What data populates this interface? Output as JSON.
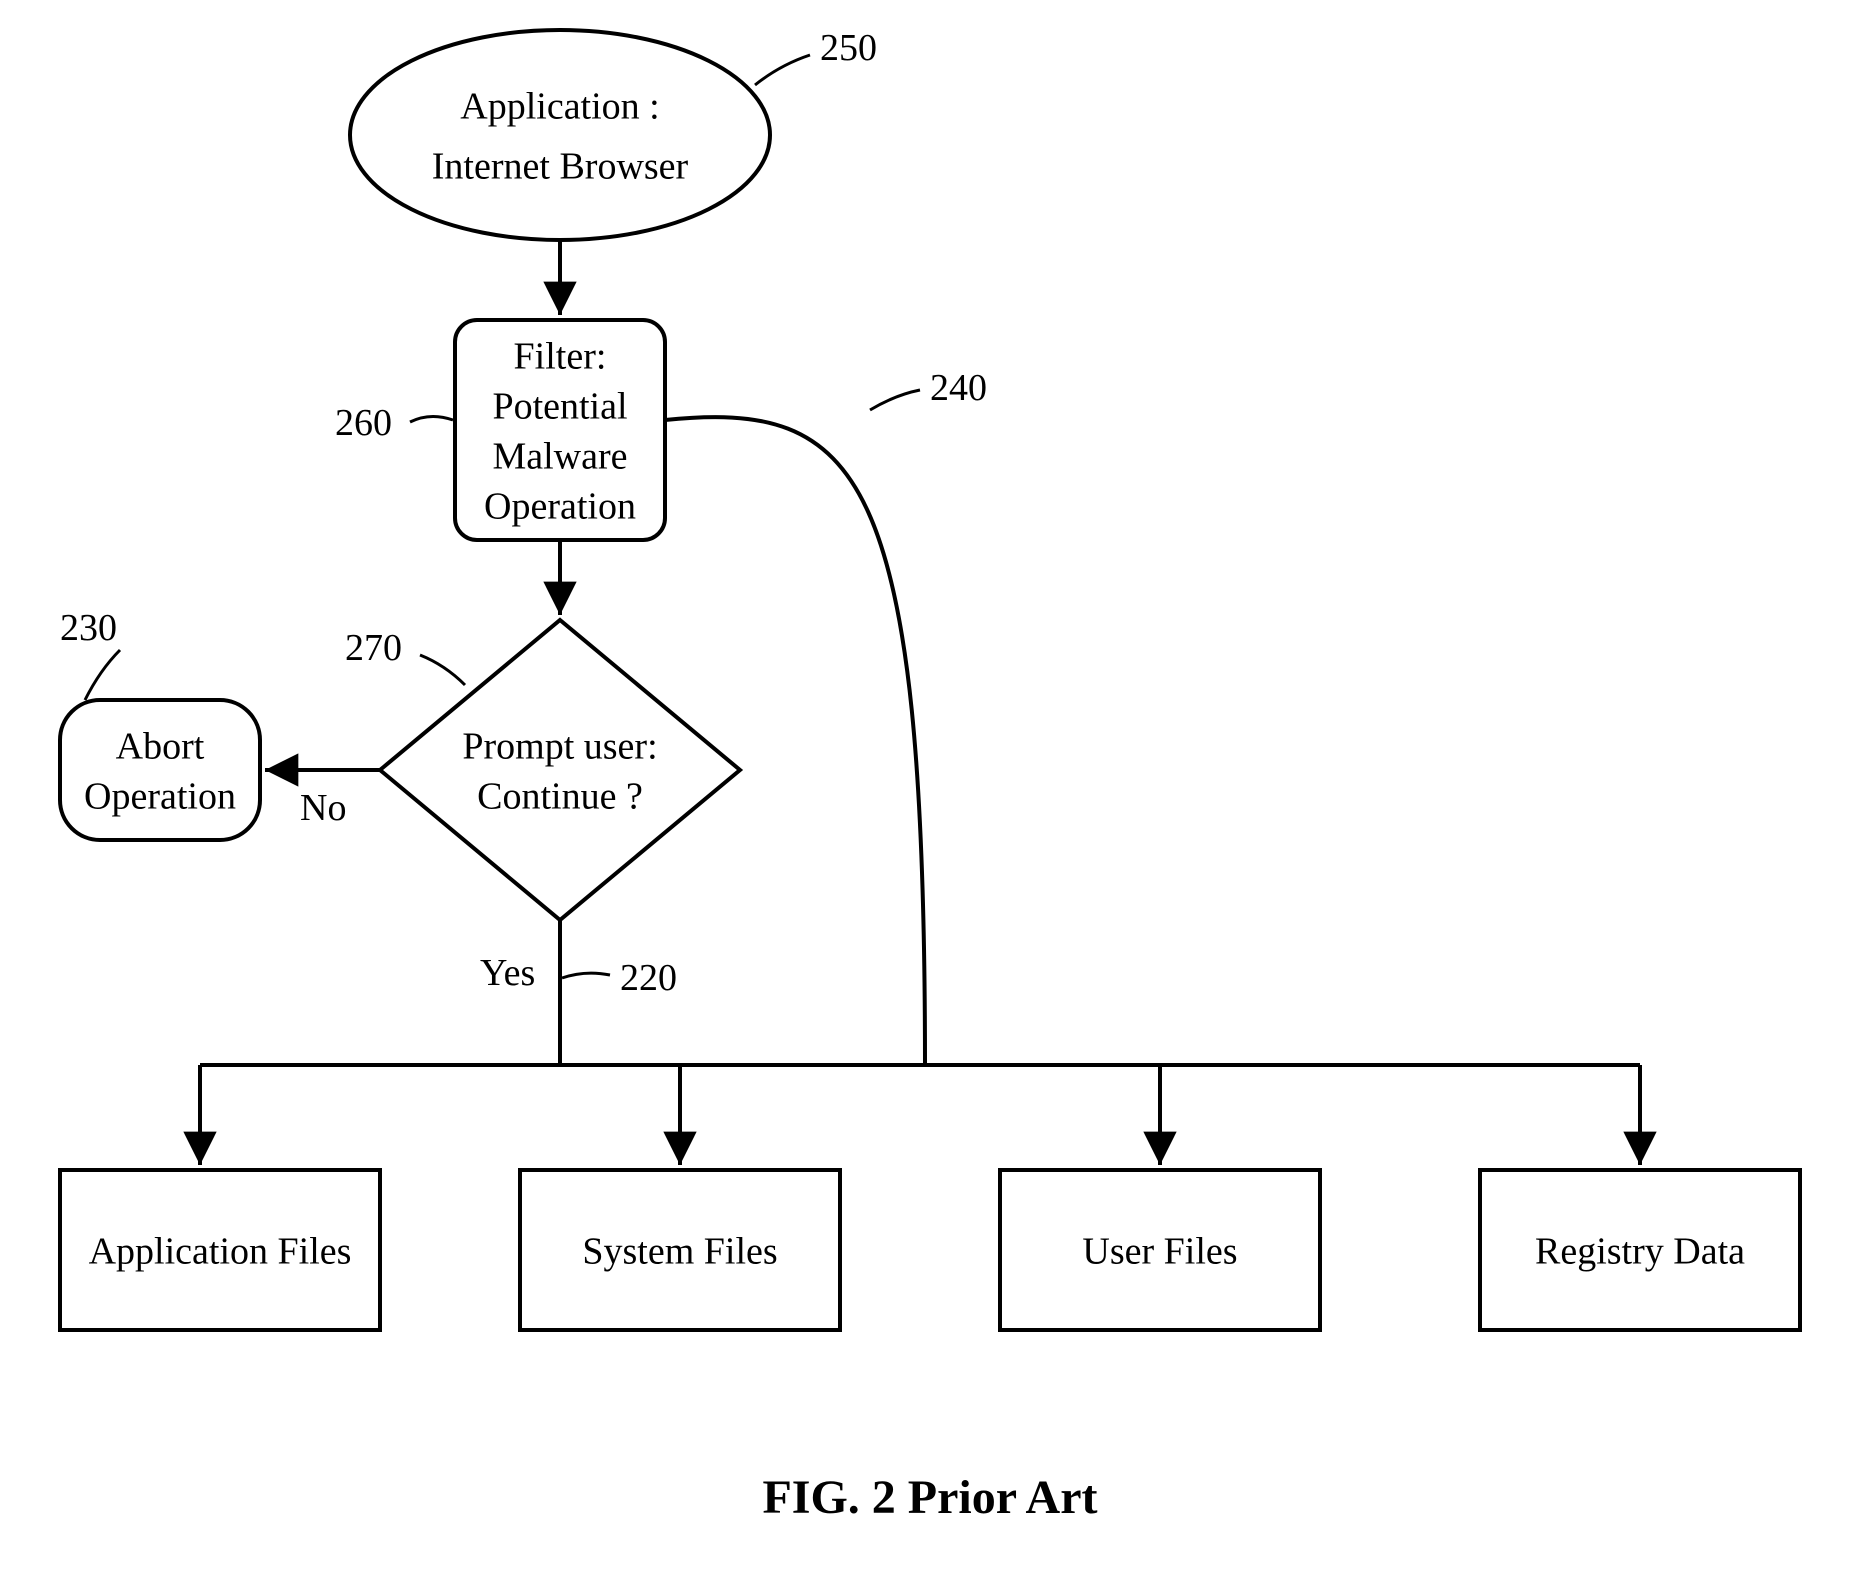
{
  "nodes": {
    "application": {
      "line1": "Application :",
      "line2": "Internet Browser",
      "ref": "250"
    },
    "filter": {
      "line1": "Filter:",
      "line2": "Potential",
      "line3": "Malware",
      "line4": "Operation",
      "ref": "260"
    },
    "decision": {
      "line1": "Prompt user:",
      "line2": "Continue ?",
      "ref": "270"
    },
    "abort": {
      "line1": "Abort",
      "line2": "Operation",
      "ref": "230"
    },
    "bypass_ref": "240",
    "yes_branch_ref": "220",
    "targets": {
      "app_files": "Application Files",
      "system_files": "System Files",
      "user_files": "User Files",
      "registry_data": "Registry Data"
    }
  },
  "edges": {
    "no": "No",
    "yes": "Yes"
  },
  "caption": "FIG. 2 Prior Art"
}
